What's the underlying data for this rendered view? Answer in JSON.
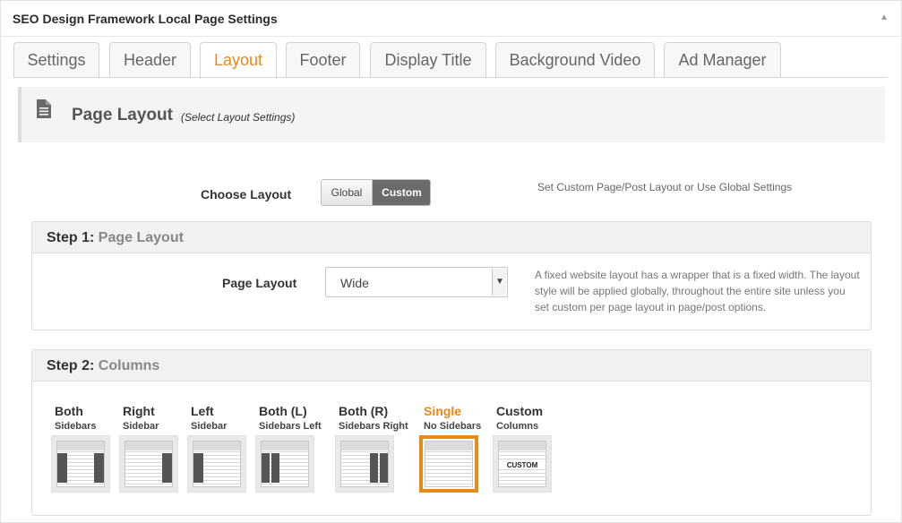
{
  "metabox": {
    "title": "SEO Design Framework Local Page Settings",
    "toggle": "▲"
  },
  "tabs": [
    {
      "label": "Settings"
    },
    {
      "label": "Header"
    },
    {
      "label": "Layout",
      "active": true
    },
    {
      "label": "Footer"
    },
    {
      "label": "Display Title"
    },
    {
      "label": "Background Video"
    },
    {
      "label": "Ad Manager"
    }
  ],
  "section": {
    "title": "Page Layout",
    "subtitle": "(Select Layout Settings)"
  },
  "choose_layout": {
    "label": "Choose Layout",
    "options": [
      "Global",
      "Custom"
    ],
    "selected": "Custom",
    "help": "Set Custom Page/Post Layout or Use Global Settings"
  },
  "step1": {
    "num": "Step 1:",
    "name": "Page Layout",
    "field_label": "Page Layout",
    "select_value": "Wide",
    "help": "A fixed website layout has a wrapper that is a fixed width. The layout style will be applied globally, throughout the entire site unless you set custom per page layout in page/post options."
  },
  "step2": {
    "num": "Step 2:",
    "name": "Columns",
    "columns": [
      {
        "name": "Both",
        "sub": "Sidebars"
      },
      {
        "name": "Right",
        "sub": "Sidebar"
      },
      {
        "name": "Left",
        "sub": "Sidebar"
      },
      {
        "name": "Both (L)",
        "sub": "Sidebars Left"
      },
      {
        "name": "Both (R)",
        "sub": "Sidebars Right"
      },
      {
        "name": "Single",
        "sub": "No Sidebars",
        "active": true
      },
      {
        "name": "Custom",
        "sub": "Columns",
        "thumb_text": "CUSTOM"
      }
    ]
  },
  "colors": {
    "accent": "#e68a1a",
    "selected_button": "#6b6b6b"
  }
}
